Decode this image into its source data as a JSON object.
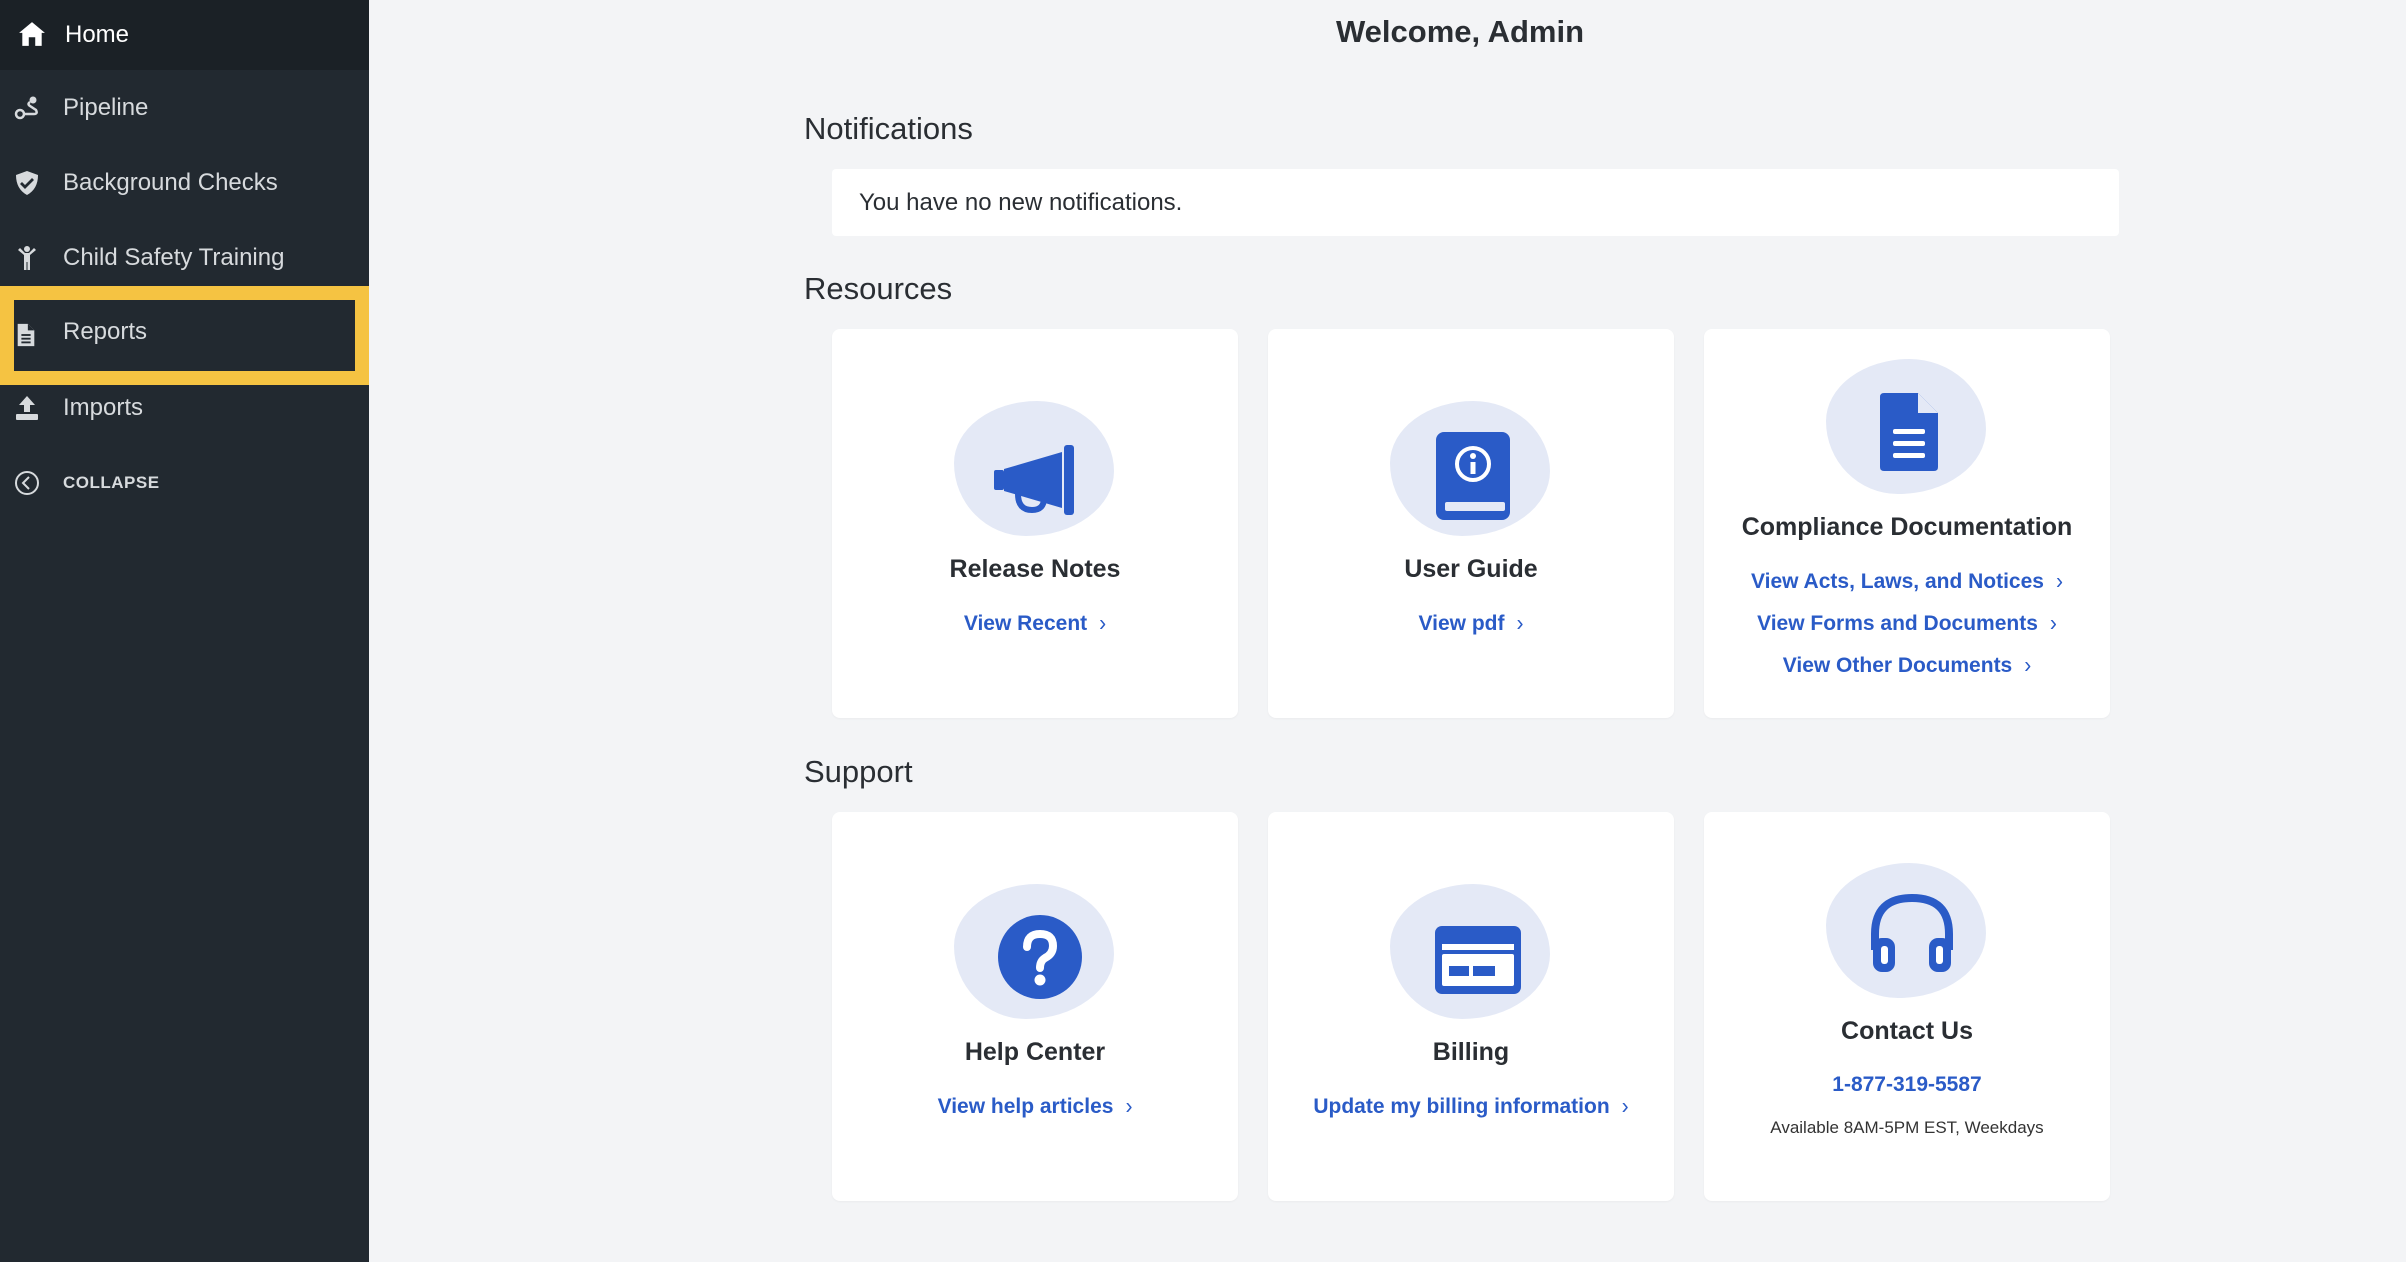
{
  "sidebar": {
    "items": [
      {
        "label": "Home"
      },
      {
        "label": "Pipeline"
      },
      {
        "label": "Background Checks"
      },
      {
        "label": "Child Safety Training"
      },
      {
        "label": "Reports"
      },
      {
        "label": "Imports"
      }
    ],
    "collapse_label": "COLLAPSE",
    "highlight_color": "#f5c342"
  },
  "main": {
    "title": "Welcome, Admin",
    "notifications": {
      "heading": "Notifications",
      "message": "You have no new notifications."
    },
    "resources": {
      "heading": "Resources",
      "cards": [
        {
          "title": "Release Notes",
          "icon": "megaphone-icon",
          "links": [
            "View Recent"
          ]
        },
        {
          "title": "User Guide",
          "icon": "info-book-icon",
          "links": [
            "View pdf"
          ]
        },
        {
          "title": "Compliance Documentation",
          "icon": "document-icon",
          "links": [
            "View Acts, Laws, and Notices",
            "View Forms and Documents",
            "View Other Documents"
          ]
        }
      ]
    },
    "support": {
      "heading": "Support",
      "cards": [
        {
          "title": "Help Center",
          "icon": "question-icon",
          "links": [
            "View help articles"
          ]
        },
        {
          "title": "Billing",
          "icon": "credit-card-icon",
          "links": [
            "Update my billing information"
          ]
        },
        {
          "title": "Contact Us",
          "icon": "headphones-icon",
          "phone": "1-877-319-5587",
          "hours": "Available 8AM-5PM EST, Weekdays"
        }
      ]
    }
  },
  "colors": {
    "accent": "#2a5bc7",
    "sidebar_bg": "#222930",
    "page_bg": "#f3f4f6"
  }
}
